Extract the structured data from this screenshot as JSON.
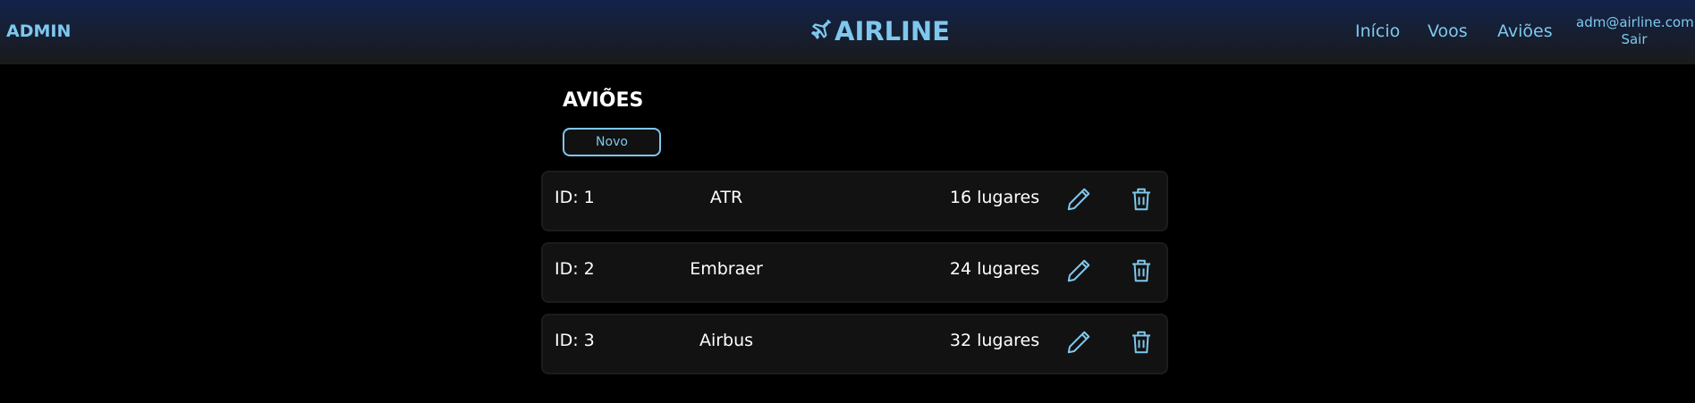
{
  "header": {
    "left_label": "ADMIN",
    "brand": "AIRLINE",
    "brand_icon": "plane-icon",
    "nav": [
      {
        "label": "Início"
      },
      {
        "label": "Voos"
      },
      {
        "label": "Aviões"
      }
    ],
    "user_email": "adm@airline.com",
    "logout_label": "Sair"
  },
  "main": {
    "title": "AVIÕES",
    "new_button": "Novo",
    "planes": [
      {
        "id": "ID: 1",
        "name": "ATR",
        "seats": "16 lugares"
      },
      {
        "id": "ID: 2",
        "name": "Embraer",
        "seats": "24 lugares"
      },
      {
        "id": "ID: 3",
        "name": "Airbus",
        "seats": "32 lugares"
      }
    ]
  },
  "colors": {
    "accent": "#7ec8ee",
    "header_top": "#12234a",
    "row_bg": "#121212"
  }
}
